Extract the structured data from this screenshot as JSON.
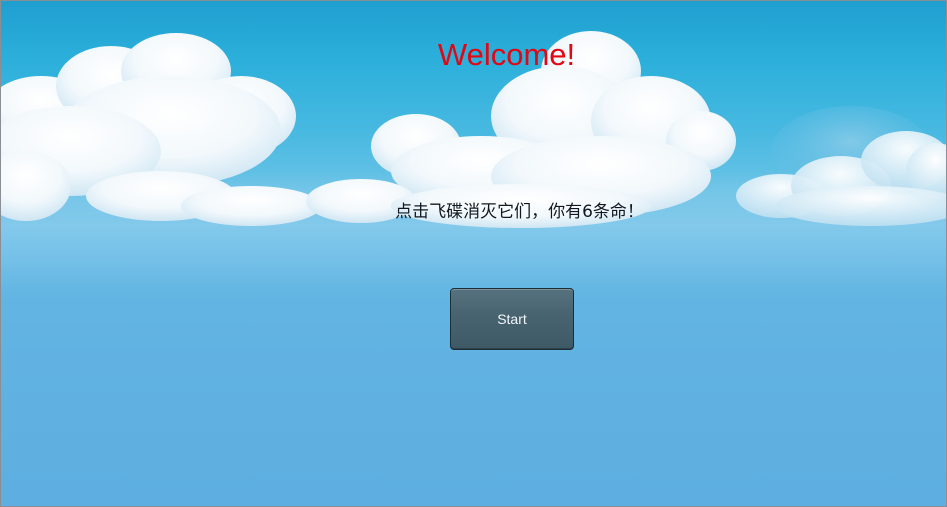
{
  "screen": {
    "title": "Welcome!",
    "instructions": "点击飞碟消灭它们，你有6条命！",
    "start_label": "Start"
  },
  "colors": {
    "title": "#e30613",
    "sky_top": "#1f9fd0",
    "sky_bottom": "#5eaee1",
    "button": "#47636f"
  }
}
